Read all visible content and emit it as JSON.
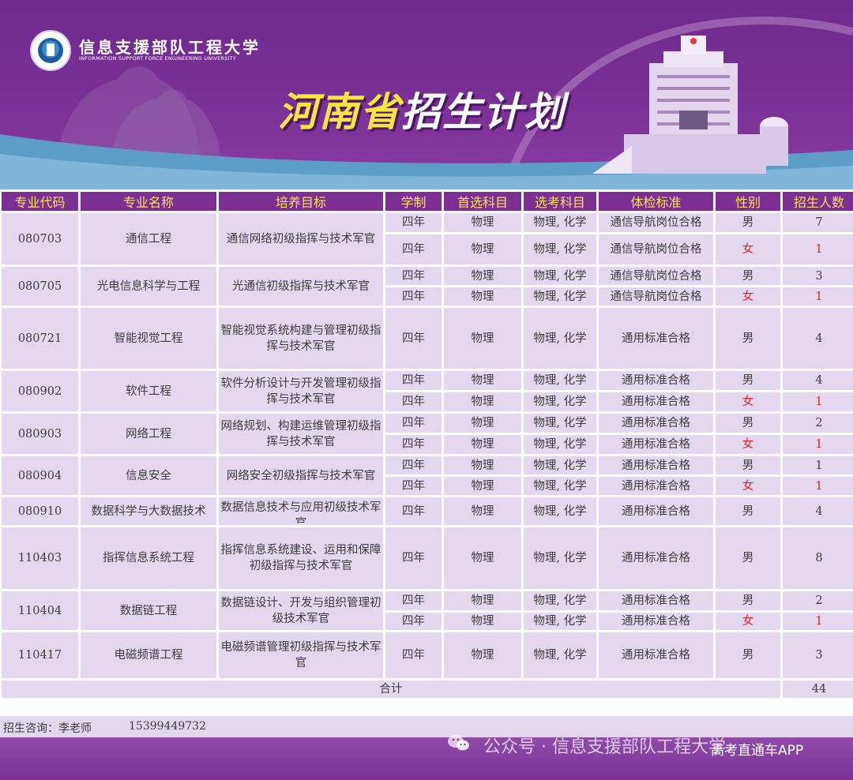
{
  "header": {
    "university_cn": "信息支援部队工程大学",
    "university_en": "INFORMATION SUPPORT FORCE ENGINEERING UNIVERSITY",
    "title_province": "河南省",
    "title_rest": "招生计划"
  },
  "colors": {
    "banner_purple": "#7a3096",
    "header_bg": "#7c2e93",
    "header_text": "#fde257",
    "cell_bg": "#e4d8ee",
    "female_red": "#e21d1d"
  },
  "columns": [
    "专业代码",
    "专业名称",
    "培养目标",
    "学制",
    "首选科目",
    "选考科目",
    "体检标准",
    "性别",
    "招生人数"
  ],
  "rows": [
    {
      "code": "080703",
      "name": "通信工程",
      "goal": "通信网络初级指挥与技术军官",
      "entries": [
        {
          "years": "四年",
          "first": "物理",
          "elective": "物理, 化学",
          "physical": "通信导航岗位合格",
          "gender": "男",
          "count": "7"
        },
        {
          "years": "四年",
          "first": "物理",
          "elective": "物理, 化学",
          "physical": "通信导航岗位合格",
          "gender": "女",
          "count": "1"
        }
      ]
    },
    {
      "code": "080705",
      "name": "光电信息科学与工程",
      "goal": "光通信初级指挥与技术军官",
      "entries": [
        {
          "years": "四年",
          "first": "物理",
          "elective": "物理, 化学",
          "physical": "通信导航岗位合格",
          "gender": "男",
          "count": "3"
        },
        {
          "years": "四年",
          "first": "物理",
          "elective": "物理, 化学",
          "physical": "通信导航岗位合格",
          "gender": "女",
          "count": "1"
        }
      ]
    },
    {
      "code": "080721",
      "name": "智能视觉工程",
      "goal": "智能视觉系统构建与管理初级指挥与技术军官",
      "entries": [
        {
          "years": "四年",
          "first": "物理",
          "elective": "物理, 化学",
          "physical": "通用标准合格",
          "gender": "男",
          "count": "4"
        }
      ]
    },
    {
      "code": "080902",
      "name": "软件工程",
      "goal": "软件分析设计与开发管理初级指挥与技术军官",
      "entries": [
        {
          "years": "四年",
          "first": "物理",
          "elective": "物理, 化学",
          "physical": "通用标准合格",
          "gender": "男",
          "count": "4"
        },
        {
          "years": "四年",
          "first": "物理",
          "elective": "物理, 化学",
          "physical": "通用标准合格",
          "gender": "女",
          "count": "1"
        }
      ]
    },
    {
      "code": "080903",
      "name": "网络工程",
      "goal": "网络规划、构建运维管理初级指挥与技术军官",
      "entries": [
        {
          "years": "四年",
          "first": "物理",
          "elective": "物理, 化学",
          "physical": "通用标准合格",
          "gender": "男",
          "count": "2"
        },
        {
          "years": "四年",
          "first": "物理",
          "elective": "物理, 化学",
          "physical": "通用标准合格",
          "gender": "女",
          "count": "1"
        }
      ]
    },
    {
      "code": "080904",
      "name": "信息安全",
      "goal": "网络安全初级指挥与技术军官",
      "entries": [
        {
          "years": "四年",
          "first": "物理",
          "elective": "物理, 化学",
          "physical": "通用标准合格",
          "gender": "男",
          "count": "1"
        },
        {
          "years": "四年",
          "first": "物理",
          "elective": "物理, 化学",
          "physical": "通用标准合格",
          "gender": "女",
          "count": "1"
        }
      ]
    },
    {
      "code": "080910",
      "name": "数据科学与大数据技术",
      "goal": "数据信息技术与应用初级技术军官",
      "entries": [
        {
          "years": "四年",
          "first": "物理",
          "elective": "物理, 化学",
          "physical": "通用标准合格",
          "gender": "男",
          "count": "4"
        }
      ]
    },
    {
      "code": "110403",
      "name": "指挥信息系统工程",
      "goal": "指挥信息系统建设、运用和保障初级指挥与技术军官",
      "entries": [
        {
          "years": "四年",
          "first": "物理",
          "elective": "物理, 化学",
          "physical": "通用标准合格",
          "gender": "男",
          "count": "8"
        }
      ]
    },
    {
      "code": "110404",
      "name": "数据链工程",
      "goal": "数据链设计、开发与组织管理初级技术军官",
      "entries": [
        {
          "years": "四年",
          "first": "物理",
          "elective": "物理, 化学",
          "physical": "通用标准合格",
          "gender": "男",
          "count": "2"
        },
        {
          "years": "四年",
          "first": "物理",
          "elective": "物理, 化学",
          "physical": "通用标准合格",
          "gender": "女",
          "count": "1"
        }
      ]
    },
    {
      "code": "110417",
      "name": "电磁频谱工程",
      "goal": "电磁频谱管理初级指挥与技术军官",
      "entries": [
        {
          "years": "四年",
          "first": "物理",
          "elective": "物理, 化学",
          "physical": "通用标准合格",
          "gender": "男",
          "count": "3"
        }
      ]
    }
  ],
  "total": {
    "label": "合计",
    "value": "44"
  },
  "contact": {
    "label": "招生咨询：李老师",
    "phone": "15399449732"
  },
  "watermark": {
    "icon": "wechat-icon",
    "text": "公众号 · 信息支援部队工程大学",
    "app": "高考直通车APP"
  }
}
